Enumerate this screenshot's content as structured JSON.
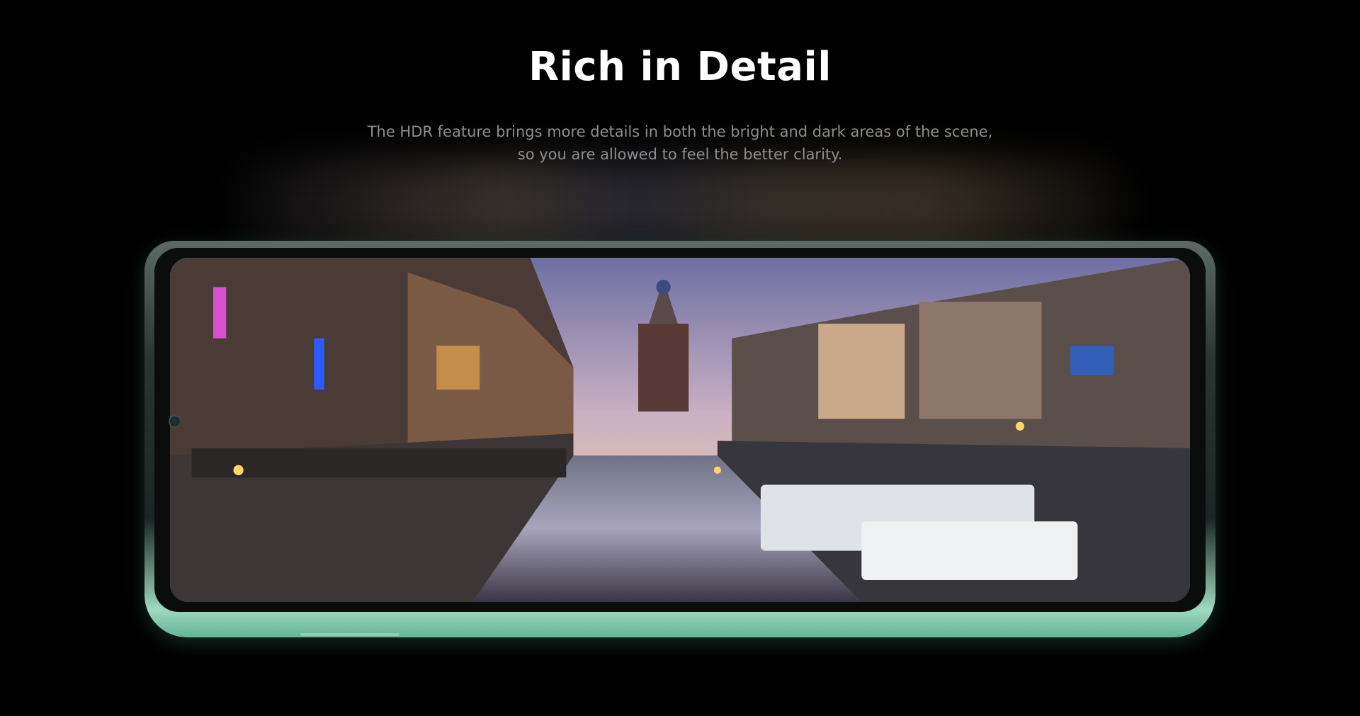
{
  "heading": {
    "title": "Rich in Detail"
  },
  "description": {
    "line1": "The HDR feature brings more details in both the bright and dark areas of the scene,",
    "line2": "so you are allowed to feel the better clarity."
  },
  "colors": {
    "background": "#000000",
    "title": "#ffffff",
    "description": "#8e8e8e",
    "phone_frame_accent": "#64b497"
  },
  "icons": {
    "front_camera": "front-camera-icon"
  }
}
